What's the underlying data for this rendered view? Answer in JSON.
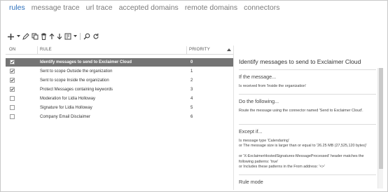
{
  "nav": {
    "tabs": [
      {
        "label": "rules",
        "active": true
      },
      {
        "label": "message trace",
        "active": false
      },
      {
        "label": "url trace",
        "active": false
      },
      {
        "label": "accepted domains",
        "active": false
      },
      {
        "label": "remote domains",
        "active": false
      },
      {
        "label": "connectors",
        "active": false
      }
    ]
  },
  "toolbar": {
    "buttons": [
      "add-icon",
      "dropdown-caret-icon",
      "edit-icon",
      "copy-icon",
      "delete-icon",
      "move-up-icon",
      "move-down-icon",
      "export-icon",
      "dropdown-caret-icon",
      "search-icon",
      "refresh-icon"
    ]
  },
  "table": {
    "headers": {
      "on": "ON",
      "rule": "RULE",
      "priority": "PRIORITY"
    },
    "rows": [
      {
        "on": true,
        "rule": "Identify messages to send to Exclaimer Cloud",
        "priority": "0",
        "selected": true
      },
      {
        "on": true,
        "rule": "Sent to scope Outside the organization",
        "priority": "1",
        "selected": false
      },
      {
        "on": true,
        "rule": "Sent to scope Inside the organization",
        "priority": "2",
        "selected": false
      },
      {
        "on": true,
        "rule": "Protect Messages containing keywords",
        "priority": "3",
        "selected": false
      },
      {
        "on": false,
        "rule": "Moderation for Lidia Holloway",
        "priority": "4",
        "selected": false
      },
      {
        "on": false,
        "rule": "Signature for Lidia Holloway",
        "priority": "5",
        "selected": false
      },
      {
        "on": false,
        "rule": "Company Email Disclaimer",
        "priority": "6",
        "selected": false
      }
    ]
  },
  "detail": {
    "title": "Identify messages to send to Exclaimer Cloud",
    "if_heading": "If the message...",
    "if_text": "Is received from 'Inside the organization'",
    "do_heading": "Do the following...",
    "do_text": "Route the message using the connector named 'Send to Exclaimer Cloud'.",
    "except_heading": "Except if...",
    "except_lines": [
      "Is message type 'Calendaring'",
      "or The message size is larger than or equal to '26.25 MB (27,525,120 bytes)'",
      "or 'X-ExclaimerHostedSignatures-MessageProcessed' header matches the following patterns: 'true'",
      "or Includes these patterns in the From address: '<>'"
    ],
    "rule_mode_heading": "Rule mode"
  },
  "colors": {
    "accent": "#2a6ebb",
    "selected_row": "#747474",
    "inactive_tab": "#7a7a7a"
  }
}
